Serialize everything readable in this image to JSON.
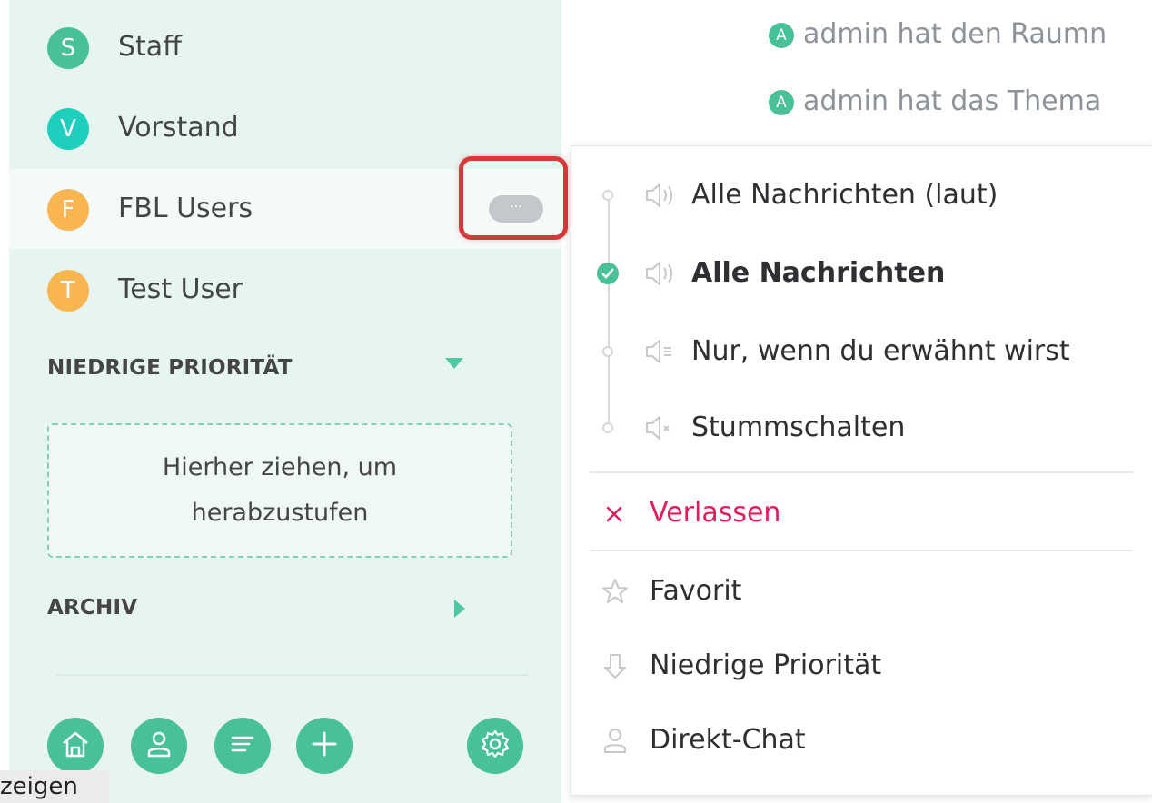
{
  "sidebar": {
    "rooms": [
      {
        "initial": "S",
        "name": "Staff",
        "color": "#48c196"
      },
      {
        "initial": "V",
        "name": "Vorstand",
        "color": "#1ecfc0"
      },
      {
        "initial": "F",
        "name": "FBL Users",
        "color": "#f9b552"
      },
      {
        "initial": "T",
        "name": "Test User",
        "color": "#f9b552"
      }
    ],
    "more_button_label": "···",
    "low_priority_header": "NIEDRIGE PRIORITÄT",
    "dropzone_text": "Hierher ziehen, um herabzustufen",
    "archive_header": "ARCHIV",
    "bottom_buttons": [
      "home-icon",
      "user-icon",
      "list-icon",
      "plus-icon",
      "gear-icon"
    ],
    "tooltip_text": "zeigen"
  },
  "timeline": {
    "events": [
      {
        "avatar": "A",
        "text": "admin hat den Raumn"
      },
      {
        "avatar": "A",
        "text": "admin hat das Thema"
      }
    ]
  },
  "context_menu": {
    "notification_options": [
      {
        "label": "Alle Nachrichten (laut)",
        "selected": false
      },
      {
        "label": "Alle Nachrichten",
        "selected": true
      },
      {
        "label": "Nur, wenn du erwähnt wirst",
        "selected": false
      },
      {
        "label": "Stummschalten",
        "selected": false
      }
    ],
    "leave_label": "Verlassen",
    "favorite_label": "Favorit",
    "low_priority_label": "Niedrige Priorität",
    "direct_chat_label": "Direkt-Chat"
  },
  "colors": {
    "accent": "#48c196",
    "sidebar_bg": "#e6f5f0",
    "leave": "#e01e5a",
    "highlight": "#d63a3a"
  }
}
